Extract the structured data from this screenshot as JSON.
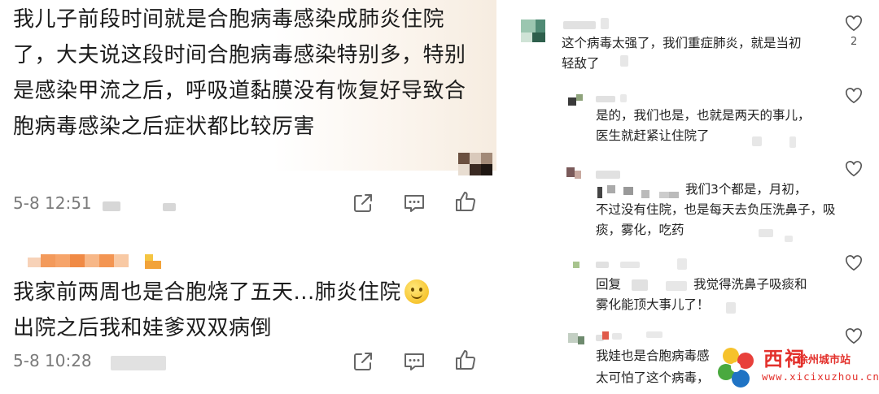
{
  "left_panel": {
    "comment1": {
      "text": "我儿子前段时间就是合胞病毒感染成肺炎住院了，大夫说这段时间合胞病毒感染特别多，特别是感染甲流之后，呼吸道黏膜没有恢复好导致合胞病毒感染之后症状都比较厉害",
      "time": "5-8 12:51"
    },
    "comment2": {
      "text": "我家前两周也是合胞烧了五天...肺炎住院",
      "text_line2": "出院之后我和娃爹双双病倒",
      "time": "5-8 10:28"
    }
  },
  "right_panel": {
    "comments": [
      {
        "text": "这个病毒太强了，我们重症肺炎，就是当初轻敌了",
        "likes": "2"
      },
      {
        "text": "是的，我们也是，也就是两天的事儿，医生就赶紧让住院了"
      },
      {
        "text_line1": "我们3个都是，月初，",
        "text_rest": "不过没有住院，也是每天去负压洗鼻子，吸痰，雾化，吃药"
      },
      {
        "reply_prefix": "回复",
        "text_line1": "我觉得洗鼻子吸痰和",
        "text_rest": "雾化能顶大事儿了！"
      },
      {
        "text_line1": "我娃也是合胞病毒感",
        "text_rest": "太可怕了这个病毒，"
      }
    ]
  },
  "watermark": {
    "brand": "西祠",
    "sub": "徐州城市站",
    "url": "www.xicixuzhou.cn"
  },
  "icons": [
    "share-icon",
    "comment-icon",
    "like-icon",
    "heart-icon"
  ]
}
